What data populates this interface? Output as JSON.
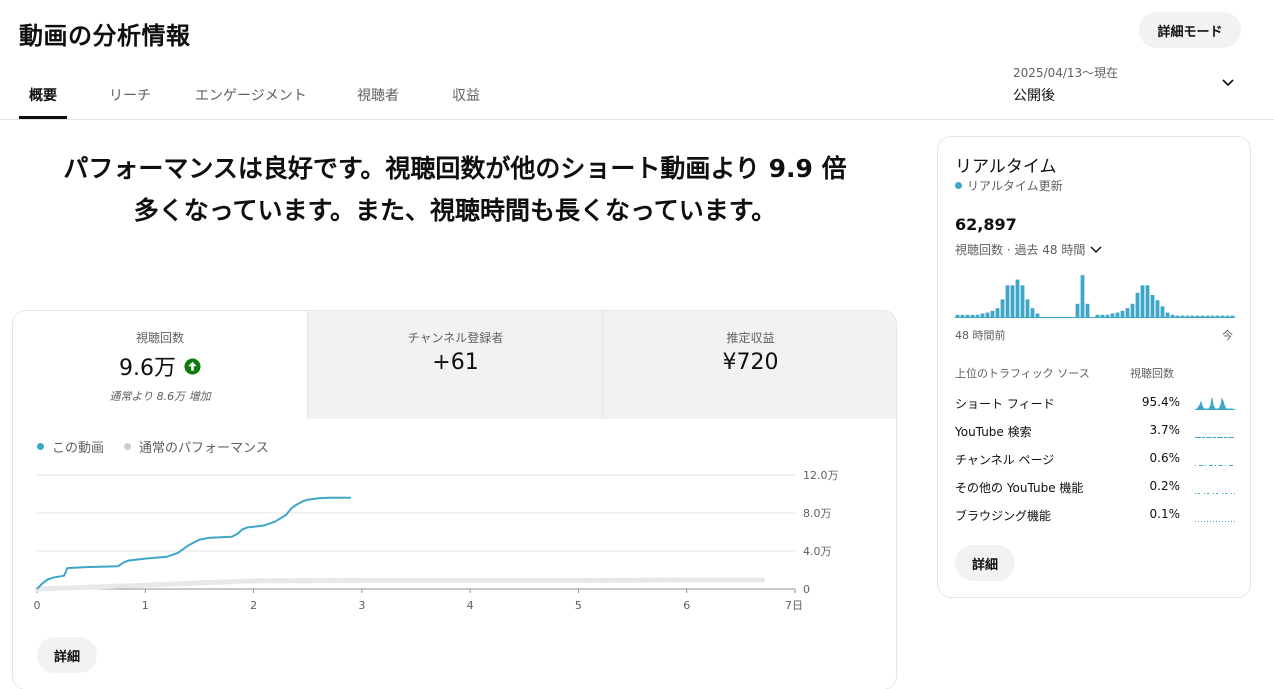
{
  "header": {
    "title": "動画の分析情報",
    "mode_button": "詳細モード"
  },
  "tabs": [
    {
      "label": "概要",
      "active": true
    },
    {
      "label": "リーチ",
      "active": false
    },
    {
      "label": "エンゲージメント",
      "active": false
    },
    {
      "label": "視聴者",
      "active": false
    },
    {
      "label": "収益",
      "active": false
    }
  ],
  "date_range": {
    "dates": "2025/04/13〜現在",
    "label": "公開後",
    "icon": "chevron-down-icon"
  },
  "headline": "パフォーマンスは良好です。視聴回数が他のショート動画より 9.9 倍多くなっています。また、視聴時間も長くなっています。",
  "metrics": [
    {
      "label": "視聴回数",
      "value": "9.6万",
      "sub": "通常より 8.6万 増加",
      "icon": "arrow-up-icon",
      "selected": true
    },
    {
      "label": "チャンネル登録者",
      "value": "+61",
      "sub": "",
      "selected": false
    },
    {
      "label": "推定収益",
      "value": "¥720",
      "sub": "",
      "selected": false
    }
  ],
  "legend": {
    "this_video": "この動画",
    "typical": "通常のパフォーマンス"
  },
  "colors": {
    "accent": "#3ea6c7",
    "typical_band": "#e8e8e8",
    "up_arrow": "#0c7a0c"
  },
  "chart_data": {
    "type": "line",
    "x_ticks": [
      "0",
      "1",
      "2",
      "3",
      "4",
      "5",
      "6",
      "7日"
    ],
    "y_ticks": [
      "0",
      "4.0万",
      "8.0万",
      "12.0万"
    ],
    "xlim": [
      0,
      7
    ],
    "ylim": [
      0,
      120000
    ],
    "grid": true,
    "series": [
      {
        "name": "この動画",
        "x": [
          0,
          0.05,
          0.1,
          0.15,
          0.25,
          0.28,
          0.45,
          0.75,
          0.8,
          0.85,
          1.0,
          1.05,
          1.2,
          1.3,
          1.4,
          1.5,
          1.6,
          1.7,
          1.8,
          1.85,
          1.9,
          1.95,
          2.0,
          2.1,
          2.2,
          2.3,
          2.35,
          2.4,
          2.45,
          2.5,
          2.6,
          2.7,
          2.8,
          2.9
        ],
        "y": [
          0,
          6000,
          10000,
          12000,
          14000,
          22000,
          23000,
          24000,
          28000,
          30000,
          32000,
          32500,
          34000,
          38000,
          46000,
          52000,
          54000,
          54500,
          55000,
          58000,
          63000,
          65000,
          65500,
          67000,
          71000,
          78000,
          85000,
          89000,
          92000,
          94000,
          95500,
          96000,
          96000,
          96000
        ]
      },
      {
        "name": "通常のパフォーマンス",
        "x": [
          0,
          0.5,
          1,
          1.5,
          2,
          3,
          4,
          5,
          6,
          6.7
        ],
        "y": [
          0,
          2000,
          4000,
          6500,
          8500,
          9000,
          9000,
          9000,
          9500,
          9500
        ]
      }
    ]
  },
  "main_details_button": "詳細",
  "realtime": {
    "title": "リアルタイム",
    "live_label": "リアルタイム更新",
    "count": "62,897",
    "sub_label": "視聴回数 · 過去 48 時間",
    "axis_left": "48 時間前",
    "axis_right": "今",
    "bars": [
      0.05,
      0.05,
      0.05,
      0.05,
      0.05,
      0.08,
      0.1,
      0.14,
      0.2,
      0.4,
      0.72,
      0.72,
      0.85,
      0.72,
      0.4,
      0.2,
      0.08,
      0,
      0,
      0,
      0,
      0,
      0,
      0,
      0.3,
      0.95,
      0.3,
      0,
      0.05,
      0.05,
      0.05,
      0.08,
      0.1,
      0.14,
      0.2,
      0.3,
      0.55,
      0.72,
      0.72,
      0.5,
      0.38,
      0.24,
      0.1,
      0.05,
      0.03,
      0.03,
      0.03,
      0.03,
      0.03,
      0.03,
      0.03,
      0.03,
      0.03,
      0.03,
      0.03,
      0.03
    ],
    "traffic_header": "上位のトラフィック ソース",
    "views_header": "視聴回数",
    "traffic_sources": [
      {
        "name": "ショート フィード",
        "pct": "95.4%"
      },
      {
        "name": "YouTube 検索",
        "pct": "3.7%"
      },
      {
        "name": "チャンネル ページ",
        "pct": "0.6%"
      },
      {
        "name": "その他の YouTube 機能",
        "pct": "0.2%"
      },
      {
        "name": "ブラウジング機能",
        "pct": "0.1%"
      }
    ],
    "details_button": "詳細"
  }
}
